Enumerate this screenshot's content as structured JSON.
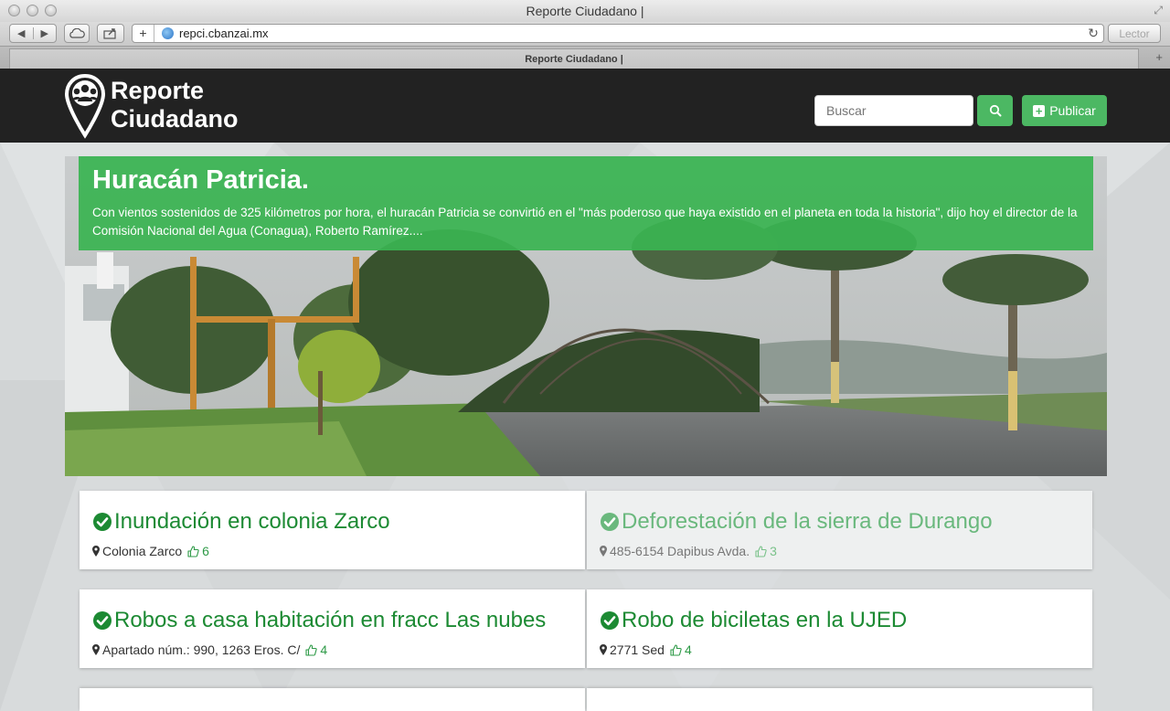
{
  "window": {
    "title": "Reporte Ciudadano |"
  },
  "browser": {
    "url": "repci.cbanzai.mx",
    "reader_label": "Lector",
    "tab_title": "Reporte Ciudadano |"
  },
  "site": {
    "brand_line1": "Reporte",
    "brand_line2": "Ciudadano",
    "search_placeholder": "Buscar",
    "publish_label": "Publicar",
    "accent": "#4cb863"
  },
  "hero": {
    "title": "Huracán Patricia.",
    "text": "Con vientos sostenidos de 325 kilómetros por hora, el huracán Patricia se convirtió en el \"más poderoso que haya existido en el planeta en toda la historia\", dijo hoy el director de la Comisión Nacional del Agua (Conagua), Roberto Ramírez...."
  },
  "reports": [
    {
      "title": "Inundación en colonia Zarco",
      "location": "Colonia Zarco",
      "likes": "6"
    },
    {
      "title": "Deforestación de la sierra de Durango",
      "location": "485-6154 Dapibus Avda.",
      "likes": "3"
    },
    {
      "title": "Robos a casa habitación en fracc Las nubes",
      "location": "Apartado núm.: 990, 1263 Eros. C/",
      "likes": "4"
    },
    {
      "title": "Robo de biciletas en la UJED",
      "location": "2771 Sed",
      "likes": "4"
    }
  ]
}
